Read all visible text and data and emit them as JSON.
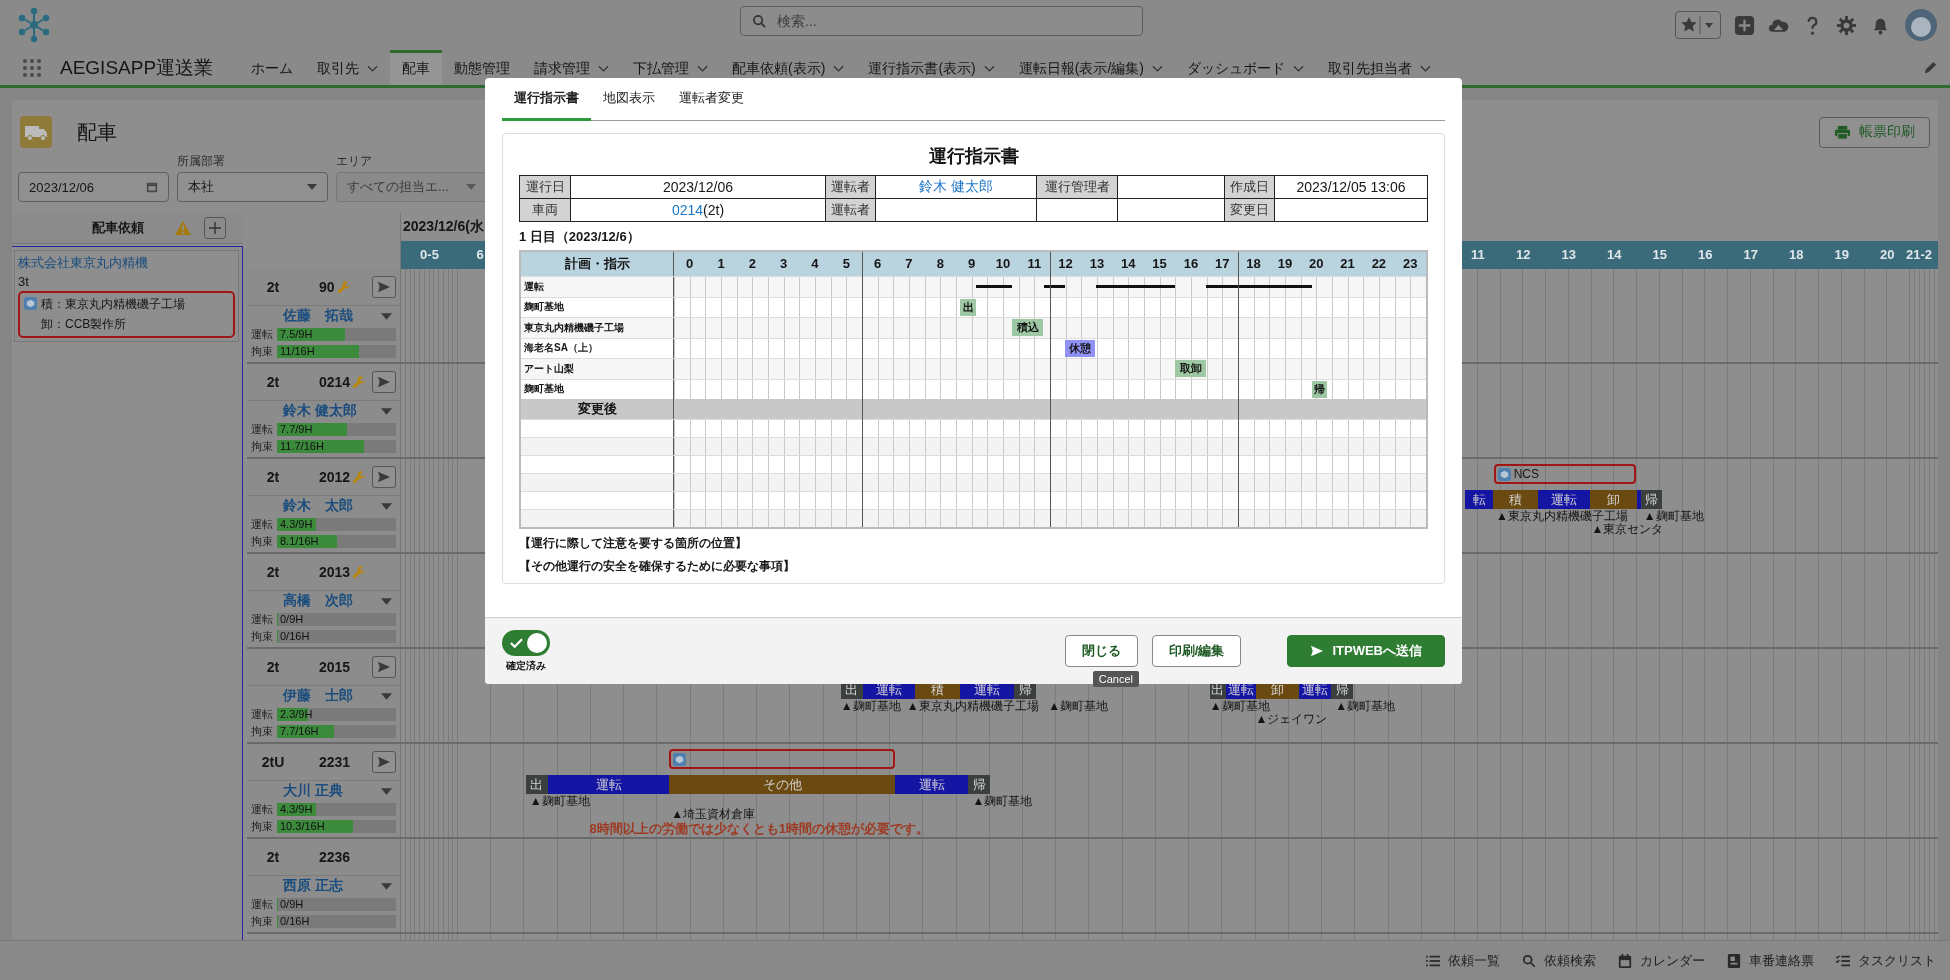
{
  "header": {
    "search": {
      "placeholder": "検索..."
    }
  },
  "nav": {
    "app_name": "AEGISAPP運送業",
    "items": [
      {
        "label": "ホーム",
        "dropdown": false,
        "selected": false
      },
      {
        "label": "取引先",
        "dropdown": true,
        "selected": false
      },
      {
        "label": "配車",
        "dropdown": false,
        "selected": true
      },
      {
        "label": "動態管理",
        "dropdown": false,
        "selected": false
      },
      {
        "label": "請求管理",
        "dropdown": true,
        "selected": false
      },
      {
        "label": "下払管理",
        "dropdown": true,
        "selected": false
      },
      {
        "label": "配車依頼(表示)",
        "dropdown": true,
        "selected": false
      },
      {
        "label": "運行指示書(表示)",
        "dropdown": true,
        "selected": false
      },
      {
        "label": "運転日報(表示/編集)",
        "dropdown": true,
        "selected": false
      },
      {
        "label": "ダッシュボード",
        "dropdown": true,
        "selected": false
      },
      {
        "label": "取引先担当者",
        "dropdown": true,
        "selected": false
      }
    ]
  },
  "page": {
    "title": "配車",
    "print_button": "帳票印刷",
    "filters": {
      "date": "2023/12/06",
      "department": {
        "label": "所属部署",
        "value": "本社"
      },
      "area": {
        "label": "エリア",
        "placeholder": "すべての担当エ..."
      }
    }
  },
  "requests_panel": {
    "title": "配車依頼",
    "requests": [
      {
        "company": "株式会社東京丸内精機",
        "size": "3t",
        "load": "積：東京丸内精機磯子工場",
        "unload": "卸：CCB製作所"
      }
    ]
  },
  "timeline": {
    "date": "2023/12/6(水",
    "hours": [
      "0-5",
      "6",
      "11",
      "12",
      "13",
      "14",
      "15",
      "16",
      "17",
      "18",
      "19",
      "20",
      "21-2"
    ],
    "vehicles": [
      {
        "size": "2t",
        "number": "90",
        "maintenance": true,
        "send": true,
        "driver": "佐藤　拓哉",
        "drive": {
          "label": "運転",
          "reading": "7.5/9H",
          "level": 0.57
        },
        "bound": {
          "label": "拘束",
          "reading": "11/16H",
          "level": 0.69
        }
      },
      {
        "size": "2t",
        "number": "0214",
        "maintenance": true,
        "send": true,
        "driver": "鈴木 健太郎",
        "drive": {
          "label": "運転",
          "reading": "7.7/9H",
          "level": 0.59
        },
        "bound": {
          "label": "拘束",
          "reading": "11.7/16H",
          "level": 0.73
        }
      },
      {
        "size": "2t",
        "number": "2012",
        "maintenance": true,
        "send": true,
        "driver": "鈴木　太郎",
        "drive": {
          "label": "運転",
          "reading": "4.3/9H",
          "level": 0.33
        },
        "bound": {
          "label": "拘束",
          "reading": "8.1/16H",
          "level": 0.5
        },
        "requests": [
          {
            "kind": "request",
            "label": "NCS"
          }
        ],
        "segments": [
          {
            "kind": "drive",
            "label": "転"
          },
          {
            "kind": "load",
            "label": "積"
          },
          {
            "kind": "drive",
            "label": "運転"
          },
          {
            "kind": "unload",
            "label": "卸"
          },
          {
            "kind": "drive"
          },
          {
            "kind": "return",
            "label": "帰"
          }
        ],
        "places": [
          "▲東京丸内精機磯子工場",
          "▲東京センタ",
          "▲麹町基地"
        ]
      },
      {
        "size": "2t",
        "number": "2013",
        "maintenance": true,
        "send": false,
        "driver": "高橋　次郎",
        "drive": {
          "label": "運転",
          "reading": "0/9H",
          "level": 0
        },
        "bound": {
          "label": "拘束",
          "reading": "0/16H",
          "level": 0
        }
      },
      {
        "size": "2t",
        "number": "2015",
        "maintenance": false,
        "send": true,
        "driver": "伊藤　士郎",
        "drive": {
          "label": "運転",
          "reading": "2.3/9H",
          "level": 0.26
        },
        "bound": {
          "label": "拘束",
          "reading": "7.7/16H",
          "level": 0.48
        },
        "segments": [
          {
            "kind": "depart",
            "label": "出"
          },
          {
            "kind": "drive",
            "label": "運転"
          },
          {
            "kind": "load",
            "label": "積"
          },
          {
            "kind": "drive",
            "label": "運転"
          },
          {
            "kind": "return",
            "label": "帰"
          },
          {
            "kind": "depart",
            "label": "出"
          },
          {
            "kind": "drive",
            "label": "運転"
          },
          {
            "kind": "unload",
            "label": "卸"
          },
          {
            "kind": "drive",
            "label": "運転"
          },
          {
            "kind": "return",
            "label": "帰"
          }
        ],
        "places": [
          "▲麹町基地",
          "▲東京丸内精機磯子工場",
          "▲麹町基地",
          "▲麹町基地",
          "▲ジェイワン",
          "▲麹町基地"
        ]
      },
      {
        "size": "2tU",
        "number": "2231",
        "maintenance": false,
        "send": true,
        "driver": "大川 正典",
        "drive": {
          "label": "運転",
          "reading": "4.3/9H",
          "level": 0.33
        },
        "bound": {
          "label": "拘束",
          "reading": "10.3/16H",
          "level": 0.64
        },
        "requests": [
          {
            "kind": "request"
          }
        ],
        "segments": [
          {
            "kind": "depart",
            "label": "出"
          },
          {
            "kind": "drive",
            "label": "運転"
          },
          {
            "kind": "other",
            "label": "その他"
          },
          {
            "kind": "drive",
            "label": "運転"
          },
          {
            "kind": "return",
            "label": "帰"
          }
        ],
        "places": [
          "▲麹町基地",
          "▲埼玉資材倉庫",
          "▲麹町基地"
        ],
        "warning": "8時間以上の労働では少なくとも1時間の休憩が必要です。"
      },
      {
        "size": "2t",
        "number": "2236",
        "maintenance": false,
        "send": false,
        "driver": "西原 正志",
        "drive": {
          "label": "運転",
          "reading": "0/9H",
          "level": 0
        },
        "bound": {
          "label": "拘束",
          "reading": "0/16H",
          "level": 0
        }
      }
    ]
  },
  "dialog": {
    "tabs": [
      {
        "label": "運行指示書",
        "selected": true
      },
      {
        "label": "地図表示",
        "selected": false
      },
      {
        "label": "運転者変更",
        "selected": false
      }
    ],
    "sheet": {
      "title": "運行指示書",
      "info": [
        [
          {
            "kind": "label",
            "text": "運行日"
          },
          {
            "kind": "value",
            "text": "2023/12/06"
          },
          {
            "kind": "label",
            "text": "運転者"
          },
          {
            "kind": "link",
            "text": "鈴木 健太郎"
          },
          {
            "kind": "label",
            "text": "運行管理者"
          },
          {
            "kind": "value"
          },
          {
            "kind": "label",
            "text": "作成日"
          },
          {
            "kind": "value",
            "text": "2023/12/05 13:06"
          }
        ],
        [
          {
            "kind": "label",
            "text": "車両"
          },
          {
            "kind": "link",
            "text": "0214",
            "suffix": "(2t)"
          },
          {
            "kind": "label",
            "text": "運転者"
          },
          {
            "kind": "value"
          },
          {
            "kind": "value"
          },
          {
            "kind": "value"
          },
          {
            "kind": "label",
            "text": "変更日"
          },
          {
            "kind": "value"
          }
        ]
      ],
      "day_label": "1 日目（2023/12/6）",
      "plan": {
        "header": "計画・指示",
        "hours": [
          "0",
          "1",
          "2",
          "3",
          "4",
          "5",
          "6",
          "7",
          "8",
          "9",
          "10",
          "11",
          "12",
          "13",
          "14",
          "15",
          "16",
          "17",
          "18",
          "19",
          "20",
          "21",
          "22",
          "23"
        ],
        "rows": [
          {
            "label": "運転",
            "kind": "drive"
          },
          {
            "label": "麹町基地",
            "kind": "stop",
            "marker": {
              "text": "出",
              "color": "#9dc8a3"
            }
          },
          {
            "label": "東京丸内精機磯子工場",
            "kind": "stop",
            "marker": {
              "text": "積込",
              "color": "#9dc8a3"
            }
          },
          {
            "label": "海老名SA（上）",
            "kind": "stop",
            "marker": {
              "text": "休憩",
              "color": "#8f91f4"
            }
          },
          {
            "label": "アート山梨",
            "kind": "stop",
            "marker": {
              "text": "取卸",
              "color": "#9dc8a3"
            }
          },
          {
            "label": "麹町基地",
            "kind": "stop",
            "marker": {
              "text": "帰",
              "color": "#9dc8a3"
            }
          }
        ],
        "changed_label": "変更後"
      },
      "notes": [
        "【運行に際して注意を要する箇所の位置】",
        "【その他運行の安全を確保するために必要な事項】"
      ]
    },
    "footer": {
      "confirmed": true,
      "confirmed_label": "確定済み",
      "buttons": [
        {
          "label": "閉じる",
          "kind": "neutral"
        },
        {
          "label": "印刷/編集",
          "kind": "neutral"
        },
        {
          "label": "ITPWEBへ送信",
          "kind": "primary"
        }
      ],
      "tooltip": "Cancel"
    }
  },
  "utility_bar": [
    "依頼一覧",
    "依頼検索",
    "カレンダー",
    "車番連絡票",
    "タスクリスト"
  ]
}
